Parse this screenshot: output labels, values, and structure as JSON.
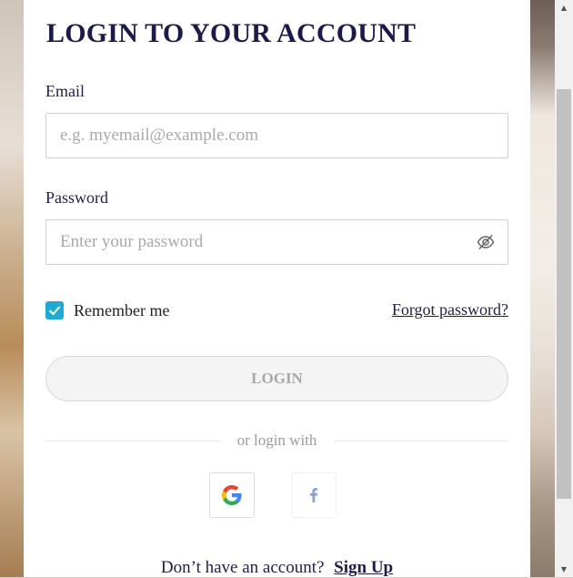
{
  "form": {
    "title": "LOGIN TO YOUR ACCOUNT",
    "email_label": "Email",
    "email_placeholder": "e.g. myemail@example.com",
    "password_label": "Password",
    "password_placeholder": "Enter your password",
    "remember_label": "Remember me",
    "remember_checked": true,
    "forgot_label": "Forgot password?",
    "login_label": "LOGIN",
    "divider_text": "or login with",
    "social": [
      {
        "icon": "google-icon"
      },
      {
        "icon": "facebook-icon"
      }
    ],
    "signup_prompt": "Don’t have an account?",
    "signup_label": "Sign Up"
  },
  "colors": {
    "heading": "#1b1b4b",
    "checkbox": "#1eaad4",
    "button_disabled_bg": "#f4f4f4"
  }
}
